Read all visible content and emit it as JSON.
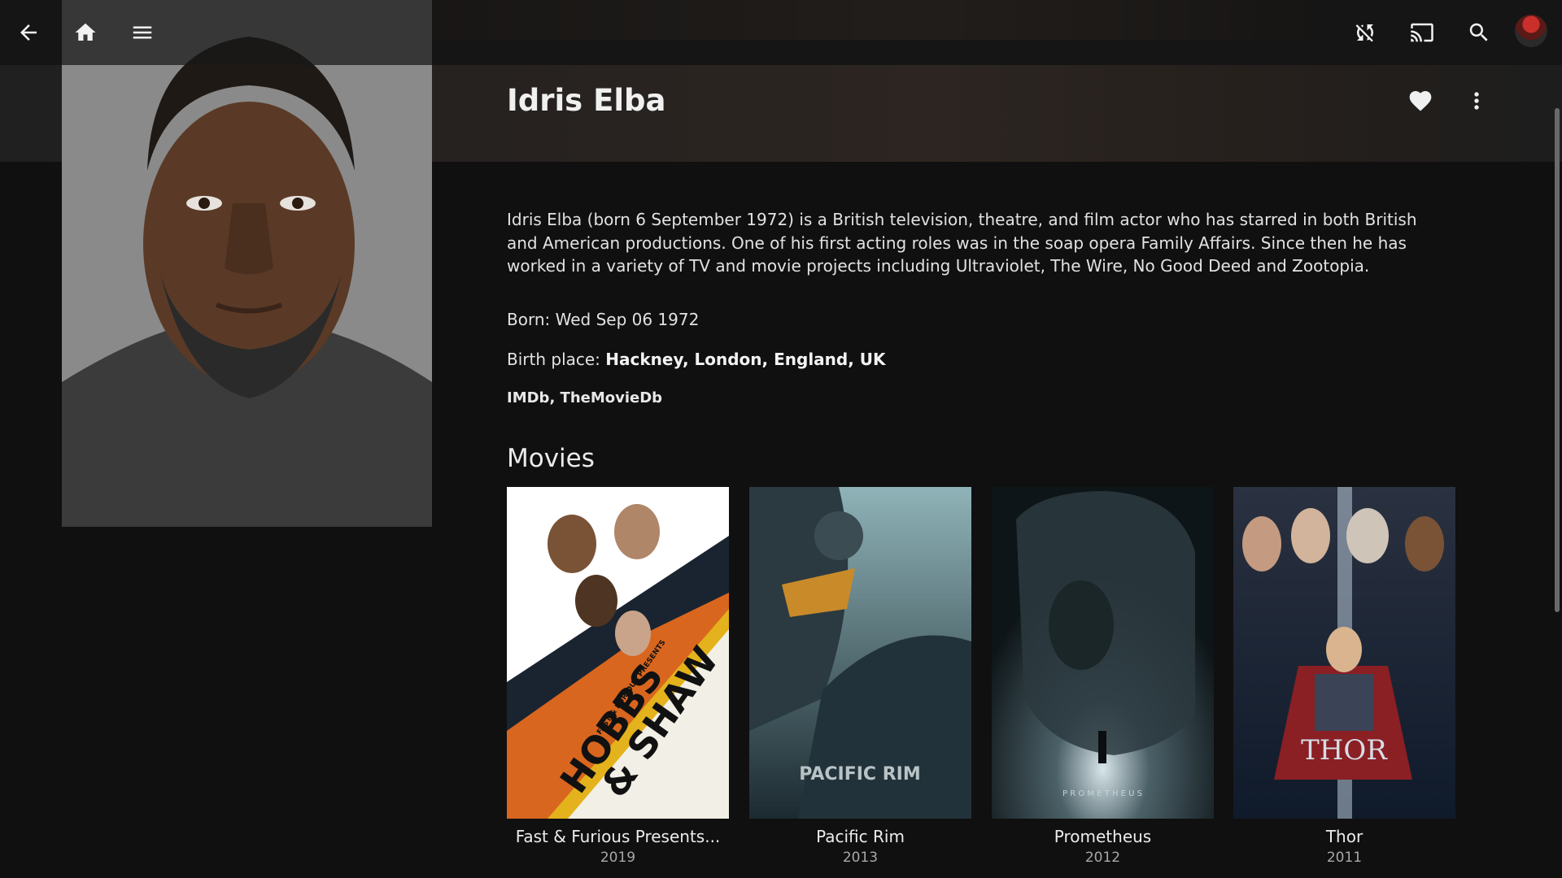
{
  "person": {
    "name": "Idris Elba",
    "overview": "Idris Elba (born 6 September 1972) is a British television, theatre, and film actor who has starred in both British and American productions. One of his first acting roles was in the soap opera Family Affairs. Since then he has worked in a variety of TV and movie projects including Ultraviolet, The Wire, No Good Deed and Zootopia.",
    "born_label": "Born:",
    "born_value": "Wed Sep 06 1972",
    "birthplace_label": "Birth place:",
    "birthplace_value": "Hackney, London, England, UK",
    "links": [
      "IMDb",
      "TheMovieDb"
    ],
    "links_separator": ", "
  },
  "toolbar": {
    "icons": [
      "back-arrow-icon",
      "home-icon",
      "menu-icon",
      "sync-disabled-icon",
      "cast-icon",
      "search-icon",
      "user-avatar"
    ]
  },
  "movies_section": {
    "title": "Movies",
    "items": [
      {
        "title": "Fast & Furious Presents...",
        "year": "2019",
        "poster_text": [
          "FAST & FURIOUS PRESENTS",
          "HOBBS",
          "& SHAW"
        ]
      },
      {
        "title": "Pacific Rim",
        "year": "2013",
        "poster_text": [
          "PACIFIC RIM"
        ]
      },
      {
        "title": "Prometheus",
        "year": "2012",
        "poster_text": [
          "P R O M E T H E U S"
        ]
      },
      {
        "title": "Thor",
        "year": "2011",
        "poster_text": [
          "THOR"
        ]
      }
    ]
  },
  "colors": {
    "background": "#101010",
    "text": "#e6e6e6",
    "muted": "#a8a8a8"
  }
}
